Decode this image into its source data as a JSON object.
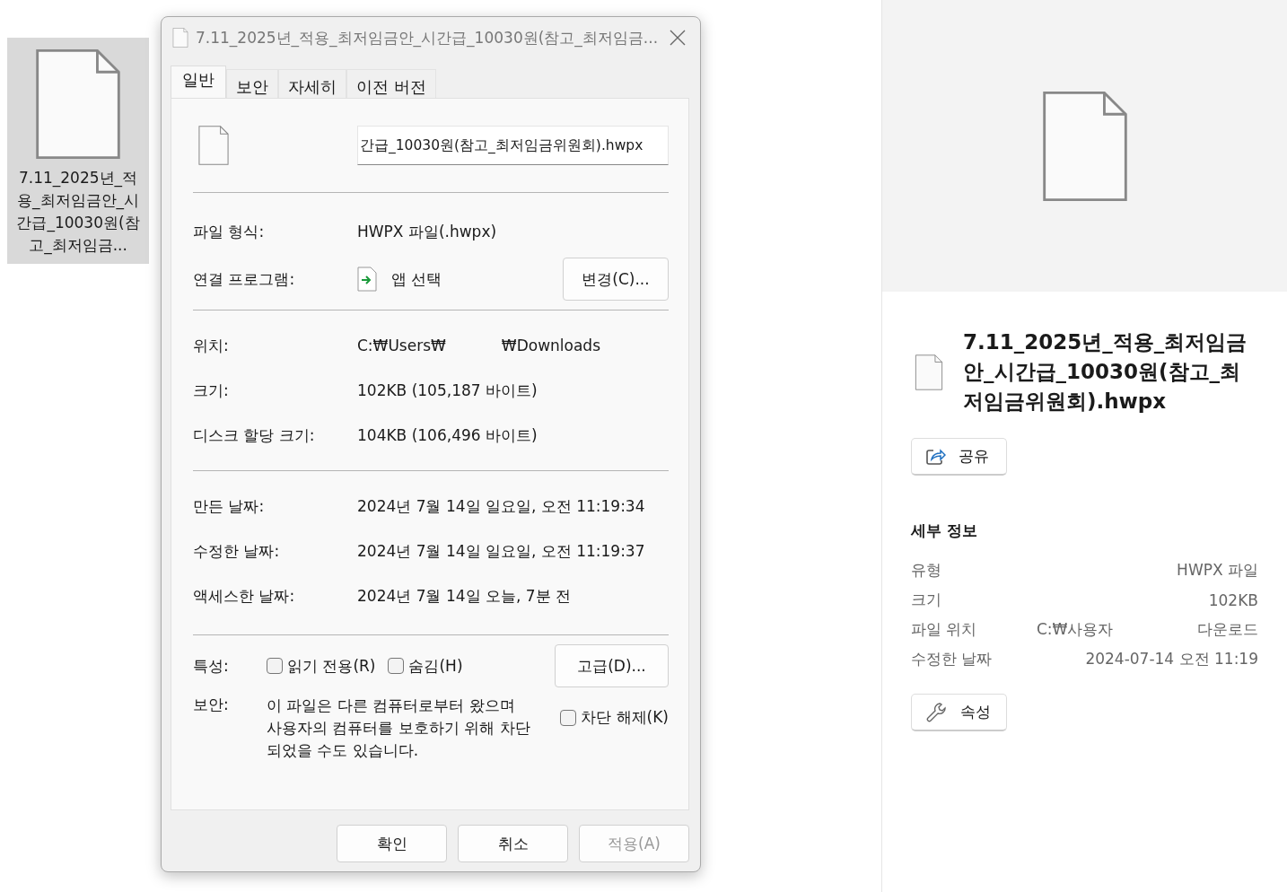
{
  "desktop_icon": {
    "label": "7.11_2025년_적용_최저임금안_시간급_10030원(참고_최저임금...",
    "selected": true
  },
  "dialog": {
    "title": "7.11_2025년_적용_최저임금안_시간급_10030원(참고_최저임금...",
    "tabs": [
      {
        "label": "일반",
        "selected": true
      },
      {
        "label": "보안",
        "selected": false
      },
      {
        "label": "자세히",
        "selected": false
      },
      {
        "label": "이전 버전",
        "selected": false
      }
    ],
    "filename_field": {
      "value": "간급_10030원(참고_최저임금위원회).hwpx"
    },
    "sections": [
      {
        "rows": [
          {
            "kind": "text",
            "label": "파일 형식:",
            "value": "HWPX 파일(.hwpx)"
          },
          {
            "kind": "app",
            "label": "연결 프로그램:",
            "value": "앱 선택",
            "button": "변경(C)..."
          }
        ]
      },
      {
        "rows": [
          {
            "kind": "location",
            "label": "위치:",
            "value": "C:₩Users₩",
            "value_end": "₩Downloads"
          },
          {
            "kind": "text",
            "label": "크기:",
            "value": "102KB (105,187 바이트)"
          },
          {
            "kind": "text",
            "label": "디스크 할당 크기:",
            "value": "104KB (106,496 바이트)"
          }
        ]
      },
      {
        "rows": [
          {
            "kind": "text",
            "label": "만든 날짜:",
            "value": "2024년 7월 14일 일요일, 오전 11:19:34"
          },
          {
            "kind": "text",
            "label": "수정한 날짜:",
            "value": "2024년 7월 14일 일요일, 오전 11:19:37"
          },
          {
            "kind": "text",
            "label": "액세스한 날짜:",
            "value": "2024년 7월 14일 오늘, 7분 전"
          }
        ]
      }
    ],
    "attributes": {
      "label": "특성:",
      "checkboxes": [
        {
          "label": "읽기 전용(R)",
          "checked": false
        },
        {
          "label": "숨김(H)",
          "checked": false
        }
      ],
      "button": "고급(D)..."
    },
    "security": {
      "label": "보안:",
      "text": "이 파일은 다른 컴퓨터로부터 왔으며 사용자의 컴퓨터를 보호하기 위해 차단되었을 수도 있습니다.",
      "checkbox": {
        "label": "차단 해제(K)",
        "checked": false
      }
    },
    "buttons": [
      {
        "label": "확인",
        "disabled": false
      },
      {
        "label": "취소",
        "disabled": false
      },
      {
        "label": "적용(A)",
        "disabled": true
      }
    ]
  },
  "details_pane": {
    "file_name": "7.11_2025년_적용_최저임금안_시간급_10030원(참고_최저임금위원회).hwpx",
    "share_button": "공유",
    "heading": "세부 정보",
    "details": [
      {
        "label": "유형",
        "value": "HWPX 파일"
      },
      {
        "label": "크기",
        "value": "102KB"
      },
      {
        "label": "파일 위치",
        "value": "C:₩사용자",
        "value_end": "다운로드"
      },
      {
        "label": "수정한 날짜",
        "value": "2024-07-14 오전 11:19"
      }
    ],
    "properties_button": "속성"
  }
}
